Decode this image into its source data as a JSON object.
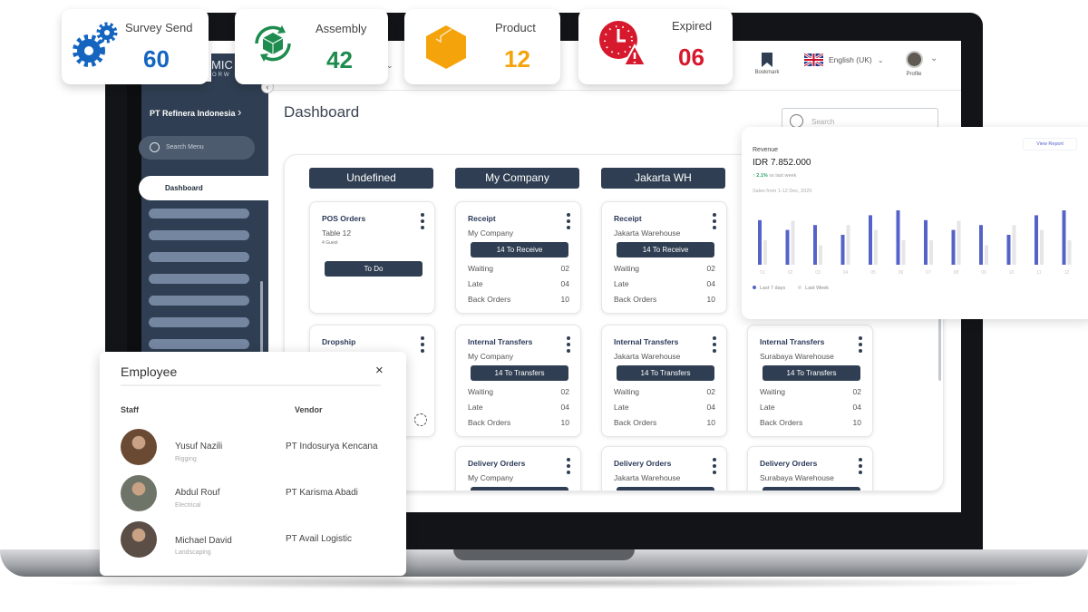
{
  "stats": [
    {
      "label": "Survey Send",
      "value": "60",
      "color": "#1565c0",
      "icon": "gears-icon"
    },
    {
      "label": "Assembly",
      "value": "42",
      "color": "#1e8c4e",
      "icon": "box-sync-icon"
    },
    {
      "label": "Product",
      "value": "12",
      "color": "#f5a30b",
      "icon": "package-icon"
    },
    {
      "label": "Expired",
      "value": "06",
      "color": "#d6192d",
      "icon": "clock-alert-icon"
    }
  ],
  "header": {
    "logo": "MIC",
    "logo_sub": "ORW",
    "bookmark": "Bookmark",
    "language": "English (UK)",
    "profile": "Profile"
  },
  "sidebar": {
    "company": "PT Refinera Indonesia",
    "search_placeholder": "Search Menu",
    "active": "Dashboard"
  },
  "main": {
    "title": "Dashboard",
    "search_placeholder": "Search"
  },
  "columns": [
    {
      "header": "Undefined",
      "cards": [
        {
          "title": "POS Orders",
          "subtitle": "Table 12",
          "note": "4 Guest",
          "button": "To Do",
          "rows": []
        },
        {
          "title": "Dropship",
          "subtitle": "",
          "button": "",
          "rows": []
        }
      ]
    },
    {
      "header": "My Company",
      "cards": [
        {
          "title": "Receipt",
          "subtitle": "My Company",
          "button": "14 To Receive",
          "rows": [
            {
              "label": "Waiting",
              "value": "02"
            },
            {
              "label": "Late",
              "value": "04"
            },
            {
              "label": "Back Orders",
              "value": "10"
            }
          ]
        },
        {
          "title": "Internal Transfers",
          "subtitle": "My Company",
          "button": "14 To Transfers",
          "rows": [
            {
              "label": "Waiting",
              "value": "02"
            },
            {
              "label": "Late",
              "value": "04"
            },
            {
              "label": "Back Orders",
              "value": "10"
            }
          ]
        },
        {
          "title": "Delivery Orders",
          "subtitle": "My Company",
          "button": "",
          "rows": []
        }
      ]
    },
    {
      "header": "Jakarta WH",
      "cards": [
        {
          "title": "Receipt",
          "subtitle": "Jakarta Warehouse",
          "button": "14 To Receive",
          "rows": [
            {
              "label": "Waiting",
              "value": "02"
            },
            {
              "label": "Late",
              "value": "04"
            },
            {
              "label": "Back Orders",
              "value": "10"
            }
          ]
        },
        {
          "title": "Internal Transfers",
          "subtitle": "Jakarta Warehouse",
          "button": "14 To Transfers",
          "rows": [
            {
              "label": "Waiting",
              "value": "02"
            },
            {
              "label": "Late",
              "value": "04"
            },
            {
              "label": "Back Orders",
              "value": "10"
            }
          ]
        },
        {
          "title": "Delivery Orders",
          "subtitle": "Jakarta Warehouse",
          "button": "",
          "rows": []
        }
      ]
    },
    {
      "header": "",
      "cards": [
        {
          "title": "Internal Transfers",
          "subtitle": "Surabaya Warehouse",
          "button": "14 To Transfers",
          "rows": [
            {
              "label": "Waiting",
              "value": "02"
            },
            {
              "label": "Late",
              "value": "04"
            },
            {
              "label": "Back Orders",
              "value": "10"
            }
          ]
        },
        {
          "title": "Delivery Orders",
          "subtitle": "Surabaya Warehouse",
          "button": "",
          "rows": []
        }
      ]
    }
  ],
  "revenue": {
    "title": "Revenue",
    "amount": "IDR 7.852.000",
    "change": "2.1%",
    "change_text": "vs last week",
    "period": "Sales from 1-12 Dec, 2020",
    "view_report": "View Report",
    "colors": {
      "current": "#5563c9",
      "previous": "#e6e6e8",
      "positive": "#2fa56a"
    }
  },
  "chart_data": {
    "type": "bar",
    "categories": [
      "01",
      "02",
      "03",
      "04",
      "05",
      "06",
      "07",
      "08",
      "09",
      "10",
      "11",
      "12"
    ],
    "series": [
      {
        "name": "Last 7 days",
        "values": [
          82,
          64,
          73,
          55,
          91,
          100,
          82,
          64,
          73,
          55,
          91,
          100
        ]
      },
      {
        "name": "Last Week",
        "values": [
          45,
          81,
          36,
          73,
          64,
          45,
          45,
          81,
          36,
          73,
          64,
          45
        ]
      }
    ],
    "ylim": [
      0,
      100
    ],
    "grid": false,
    "legend": "bottom-left"
  },
  "employee": {
    "title": "Employee",
    "staff_label": "Staff",
    "vendor_label": "Vendor",
    "rows": [
      {
        "name": "Yusuf Nazili",
        "role": "Rigging",
        "vendor": "PT Indosurya Kencana",
        "avatar_color": "#6b4a33"
      },
      {
        "name": "Abdul Rouf",
        "role": "Electrical",
        "vendor": "PT Karisma Abadi",
        "avatar_color": "#6f7468"
      },
      {
        "name": "Michael David",
        "role": "Landscaping",
        "vendor": "PT Avail Logistic",
        "avatar_color": "#5a4e46"
      }
    ]
  }
}
